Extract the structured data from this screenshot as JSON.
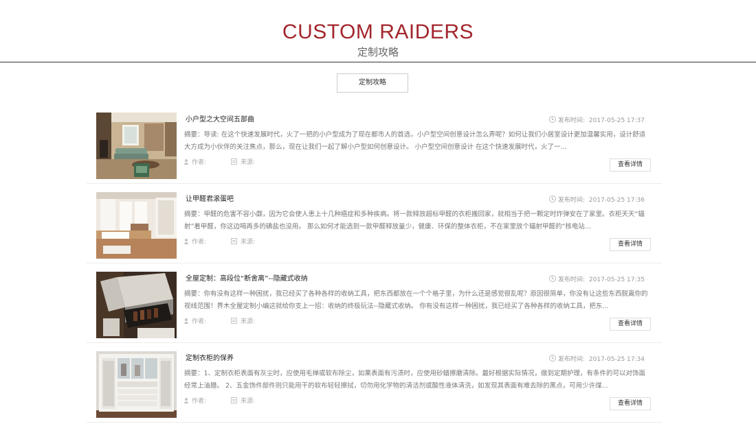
{
  "header": {
    "title_en": "CUSTOM RAIDERS",
    "title_cn": "定制攻略"
  },
  "tab": {
    "label": "定制攻略"
  },
  "labels": {
    "date": "发布时间:",
    "author": "作者:",
    "source": "来源:",
    "detail": "查看详情"
  },
  "articles": [
    {
      "title": "小户型之大空间五部曲",
      "date": "2017-05-25 17:37",
      "summary": "摘要：导读:             在这个快速发展时代，火了一把的小户型成为了现在都市人的首选，小户型空间创意设计怎么弄呢？如何让我们小居室设计更加温馨实用，设计舒适大方成为小伙伴的关注焦点，那么，现在让我们一起了解小户型如何创意设计。            小户型空间创意设计            在这个快速发展时代，火了一..."
    },
    {
      "title": "让甲醛君滚蛋吧",
      "date": "2017-05-25 17:36",
      "summary": "摘要：甲醛的危害不容小觑，因为它会使人患上十几种癌症和多种疾病。将一款释放超标甲醛的衣柜搬回家，就相当于把一颗定时炸弹安在了家里。衣柜天天“辐射”着甲醛，你这边喝再多的碘盐也没用。            那么如何才能选到一款甲醛释放量少，健康、环保的整体衣柜，不在家里放个辐射甲醛的“核电站..."
    },
    {
      "title": "全屋定制：高段位“断舍离”--隐藏式收纳",
      "date": "2017-05-25 17:35",
      "summary": "摘要：你有没有这样一种困扰，我已经买了各种各样的收纳工具，把东西都放在一个个格子里，为什么还是感觉很乱呢？原因很简单，你没有让这些东西脱离你的视线范围！界木全屋定制小编这就给你支上一招：收纳的终极玩法--隐藏式收纳。            你有没有这样一种困扰，我已经买了各种各样的收纳工具，把东..."
    },
    {
      "title": "定制衣柜的保养",
      "date": "2017-05-25 17:34",
      "summary": "摘要：1、定制衣柜表面有灰尘时，应使用毛掸或软布除尘，如果表面有污渍时，应使用砂蜡擦磨清除。最好根据实际情况，做到定期护理，有条件的可以对饰面经常上油腊。            2、五金饰件部件则只能用干的软布轻轻擦拭，切勿用化学物的清洁剂或酸性液体清洗，如发现其表面有难去除的黑点，可用少许煤..."
    }
  ]
}
